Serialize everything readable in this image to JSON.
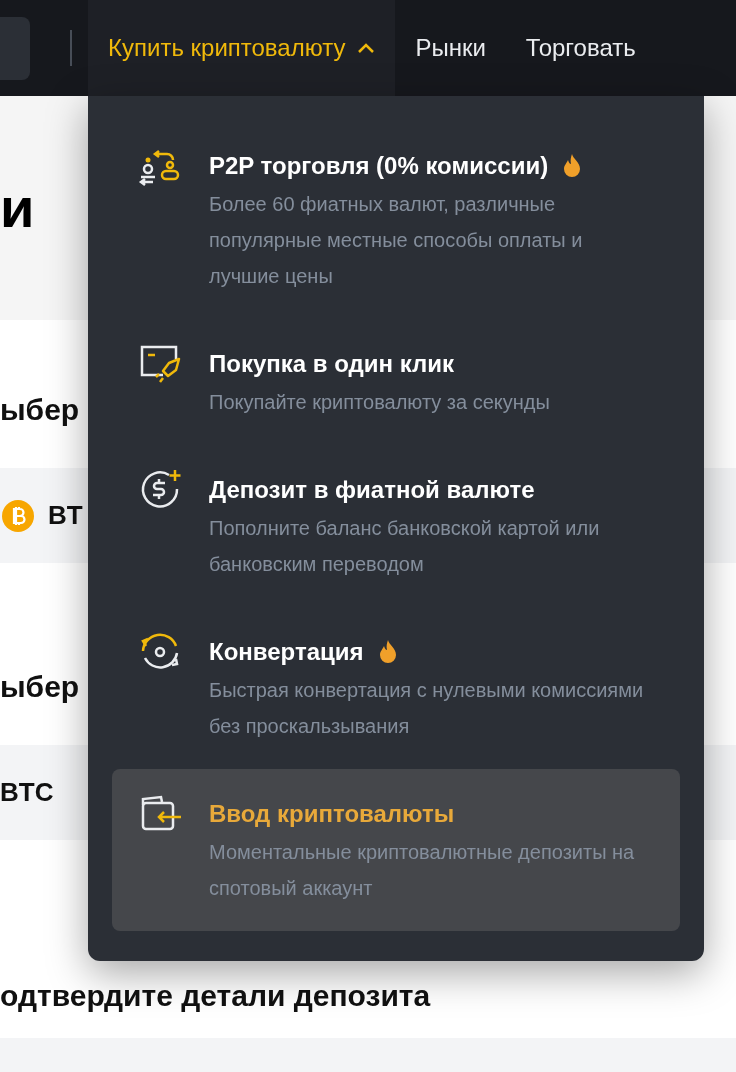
{
  "nav": {
    "items": [
      {
        "label": "Купить криптовалюту",
        "selected": true,
        "expanded": true
      },
      {
        "label": "Рынки",
        "selected": false,
        "expanded": false
      },
      {
        "label": "Торговать",
        "selected": false,
        "expanded": false
      }
    ]
  },
  "page": {
    "sections": [
      {
        "kind": "banner",
        "text": "и"
      },
      {
        "kind": "heading",
        "text": "ыбер"
      },
      {
        "kind": "coin_row",
        "text": "BT"
      },
      {
        "kind": "heading",
        "text": "ыбер"
      },
      {
        "kind": "row",
        "text": "BTC"
      },
      {
        "kind": "heading",
        "text": "одтвердите детали депозита"
      },
      {
        "kind": "band"
      }
    ]
  },
  "menu": {
    "items": [
      {
        "title": "P2P торговля (0% комиссии)",
        "description": "Более 60 фиатных валют, различные популярные местные способы оплаты и лучшие цены",
        "hot": true,
        "selected": false
      },
      {
        "title": "Покупка в один клик",
        "description": "Покупайте криптовалюту за секунды",
        "hot": false,
        "selected": false
      },
      {
        "title": "Депозит в фиатной валюте",
        "description": "Пополните баланс банковской картой или банковским переводом",
        "hot": false,
        "selected": false
      },
      {
        "title": "Конвертация",
        "description": "Быстрая конвертация с нулевыми комиссиями без проскальзывания",
        "hot": true,
        "selected": false
      },
      {
        "title": "Ввод криптовалюты",
        "description": "Моментальные криптовалютные депозиты на спотовый аккаунт",
        "hot": false,
        "selected": true
      }
    ]
  }
}
